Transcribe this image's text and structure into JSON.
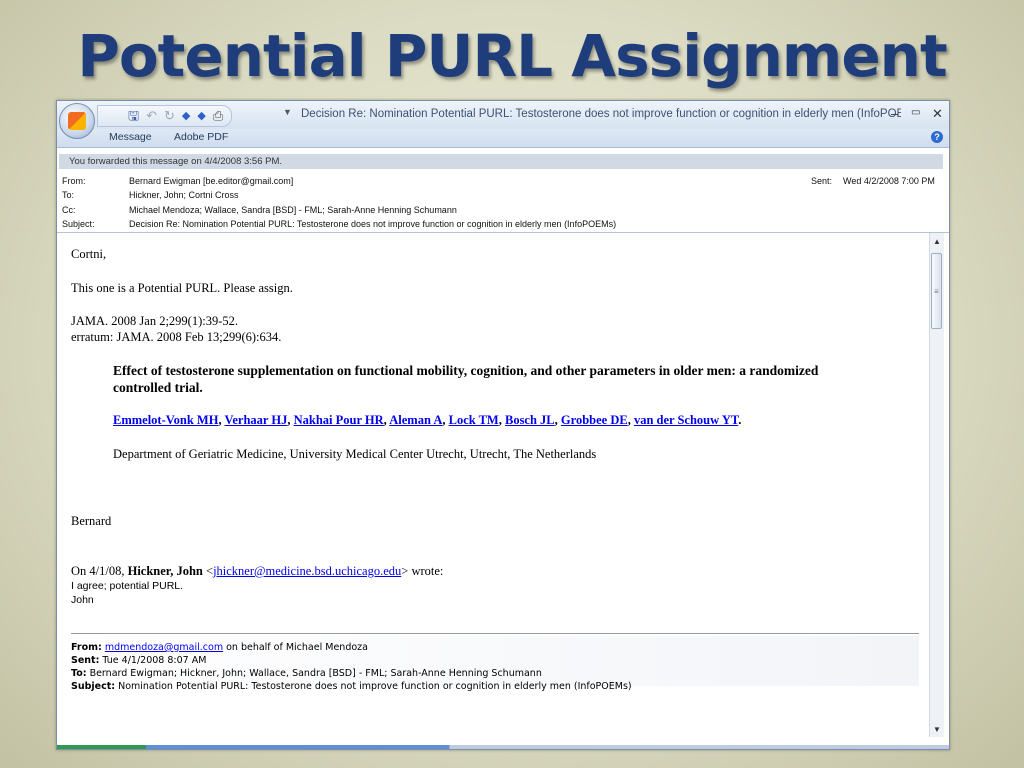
{
  "slide": {
    "title": "Potential PURL Assignment"
  },
  "window": {
    "title": "Decision Re: Nomination Potential PURL: Testosterone does not improve function or cognition in elderly men (InfoPOEMs) ..!",
    "tabs": [
      "Message",
      "Adobe PDF"
    ],
    "controls": {
      "minimize": "–",
      "restore": "▭",
      "close": "✕"
    },
    "help": "?"
  },
  "info_bar": "You forwarded this message on 4/4/2008 3:56 PM.",
  "headers": {
    "from_label": "From:",
    "from": "Bernard Ewigman [be.editor@gmail.com]",
    "to_label": "To:",
    "to": "Hickner, John; Cortni Cross",
    "cc_label": "Cc:",
    "cc": "Michael Mendoza; Wallace, Sandra [BSD] - FML; Sarah-Anne Henning Schumann",
    "subject_label": "Subject:",
    "subject": "Decision Re: Nomination Potential PURL: Testosterone does not improve function or cognition in elderly men (InfoPOEMs)",
    "sent_label": "Sent:",
    "sent": "Wed 4/2/2008 7:00 PM"
  },
  "body": {
    "greeting": "Cortni,",
    "line1": "This one is a Potential PURL.  Please assign.",
    "citation1": "JAMA. 2008 Jan 2;299(1):39-52.",
    "citation2": "erratum: JAMA. 2008 Feb 13;299(6):634.",
    "article_title": "Effect of testosterone supplementation on functional mobility, cognition, and other parameters in older men: a randomized controlled trial.",
    "authors": [
      "Emmelot-Vonk MH",
      "Verhaar HJ",
      "Nakhai Pour HR",
      "Aleman A",
      "Lock TM",
      "Bosch JL",
      "Grobbee DE",
      "van der Schouw YT"
    ],
    "affiliation": "Department of Geriatric Medicine, University Medical Center Utrecht, Utrecht, The Netherlands",
    "signature": "Bernard",
    "reply_intro_prefix": "On 4/1/08, ",
    "reply_author": "Hickner, John",
    "reply_email": "jhickner@medicine.bsd.uchicago.edu",
    "reply_suffix": " wrote:",
    "reply_line1": "I agree; potential PURL.",
    "reply_line2": "John"
  },
  "quoted": {
    "from_label": "From:",
    "from_email": "mdmendoza@gmail.com",
    "from_rest": " on behalf of Michael Mendoza",
    "sent_label": "Sent:",
    "sent": " Tue 4/1/2008 8:07 AM",
    "to_label": "To:",
    "to": " Bernard Ewigman; Hickner, John; Wallace, Sandra [BSD] - FML; Sarah-Anne Henning Schumann",
    "subject_label": "Subject:",
    "subject": " Nomination Potential PURL: Testosterone does not improve function or cognition in elderly men (InfoPOEMs)"
  },
  "icons": {
    "office": "office-button-icon",
    "save": "save-icon",
    "undo": "undo-icon",
    "redo": "redo-icon",
    "prev": "previous-item-icon",
    "next": "next-item-icon",
    "print": "print-icon"
  }
}
